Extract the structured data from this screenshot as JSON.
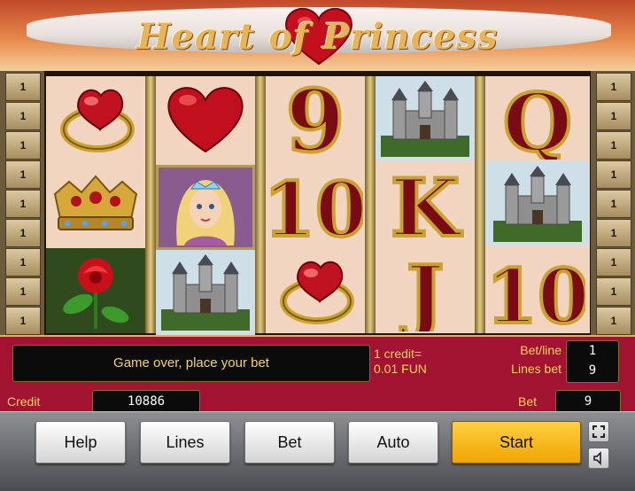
{
  "game": {
    "title": "Heart of Princess"
  },
  "lines": {
    "left": [
      "1",
      "1",
      "1",
      "1",
      "1",
      "1",
      "1",
      "1",
      "1"
    ],
    "right": [
      "1",
      "1",
      "1",
      "1",
      "1",
      "1",
      "1",
      "1",
      "1"
    ]
  },
  "reels": [
    [
      "ring",
      "crown",
      "rose"
    ],
    [
      "heart",
      "princess",
      "castle"
    ],
    [
      "nine",
      "ten",
      "ring"
    ],
    [
      "castle",
      "king",
      "jack"
    ],
    [
      "queen",
      "castle",
      "ten"
    ]
  ],
  "symbols": {
    "nine": "9",
    "ten": "10",
    "king": "K",
    "queen": "Q",
    "jack": "J"
  },
  "panel": {
    "message": "Game over, place your bet",
    "credit_rate_line1": "1 credit=",
    "credit_rate_line2": "0.01 FUN",
    "bet_line_label": "Bet/line",
    "bet_line_value": "1",
    "lines_bet_label": "Lines bet",
    "lines_bet_value": "9",
    "credit_label": "Credit",
    "credit_value": "10886",
    "bet_label": "Bet",
    "bet_value": "9"
  },
  "buttons": {
    "help": "Help",
    "lines": "Lines",
    "bet": "Bet",
    "auto": "Auto",
    "start": "Start"
  },
  "colors": {
    "panel": "#a11330",
    "start": "#f0a500",
    "text_yellow": "#f7d55e"
  }
}
